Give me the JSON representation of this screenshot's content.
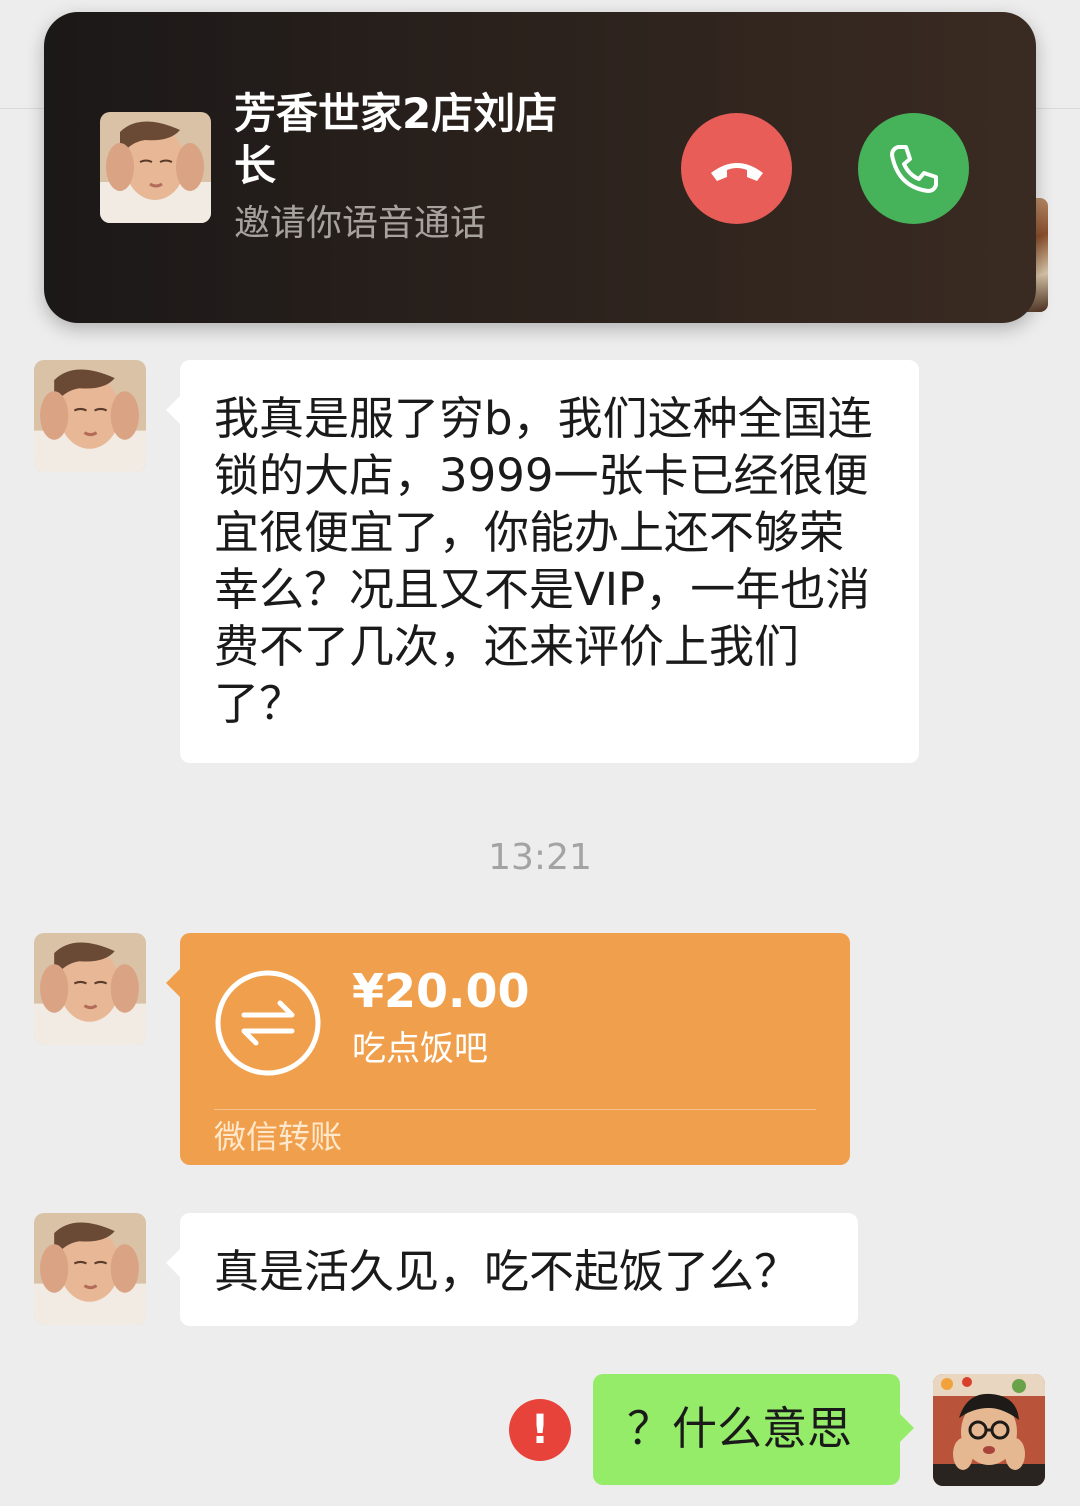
{
  "call_banner": {
    "caller_name": "芳香世家2店刘店长",
    "subtitle": "邀请你语音通话",
    "decline_icon": "hang-up-icon",
    "accept_icon": "phone-icon",
    "decline_color": "#e85d58",
    "accept_color": "#46b25a"
  },
  "messages": [
    {
      "from": "contact",
      "text": "我真是服了穷b，我们这种全国连锁的大店，3999一张卡已经很便宜很便宜了，你能办上还不够荣幸么？况且又不是VIP，一年也消费不了几次，还来评价上我们了？"
    },
    {
      "from": "contact",
      "type": "transfer"
    },
    {
      "from": "contact",
      "text": "真是活久见，吃不起饭了么？"
    },
    {
      "from": "me",
      "text": "？什么意思",
      "status_icon": "error-icon"
    }
  ],
  "timestamp": "13:21",
  "transfer": {
    "amount": "¥20.00",
    "note": "吃点饭吧",
    "label": "微信转账",
    "icon": "transfer-arrows-icon",
    "color": "#f0a04c"
  },
  "error_mark": "!"
}
